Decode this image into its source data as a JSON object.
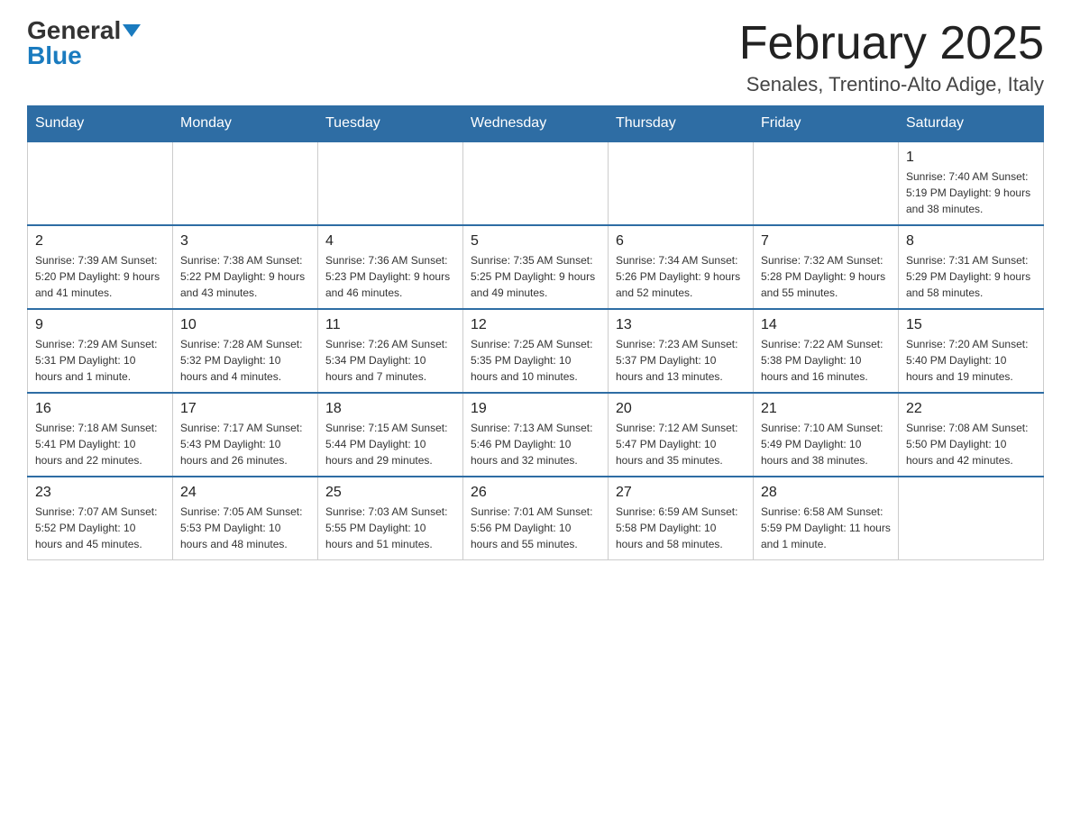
{
  "logo": {
    "general": "General",
    "blue": "Blue"
  },
  "title": "February 2025",
  "location": "Senales, Trentino-Alto Adige, Italy",
  "days_of_week": [
    "Sunday",
    "Monday",
    "Tuesday",
    "Wednesday",
    "Thursday",
    "Friday",
    "Saturday"
  ],
  "weeks": [
    [
      {
        "day": "",
        "info": ""
      },
      {
        "day": "",
        "info": ""
      },
      {
        "day": "",
        "info": ""
      },
      {
        "day": "",
        "info": ""
      },
      {
        "day": "",
        "info": ""
      },
      {
        "day": "",
        "info": ""
      },
      {
        "day": "1",
        "info": "Sunrise: 7:40 AM\nSunset: 5:19 PM\nDaylight: 9 hours and 38 minutes."
      }
    ],
    [
      {
        "day": "2",
        "info": "Sunrise: 7:39 AM\nSunset: 5:20 PM\nDaylight: 9 hours and 41 minutes."
      },
      {
        "day": "3",
        "info": "Sunrise: 7:38 AM\nSunset: 5:22 PM\nDaylight: 9 hours and 43 minutes."
      },
      {
        "day": "4",
        "info": "Sunrise: 7:36 AM\nSunset: 5:23 PM\nDaylight: 9 hours and 46 minutes."
      },
      {
        "day": "5",
        "info": "Sunrise: 7:35 AM\nSunset: 5:25 PM\nDaylight: 9 hours and 49 minutes."
      },
      {
        "day": "6",
        "info": "Sunrise: 7:34 AM\nSunset: 5:26 PM\nDaylight: 9 hours and 52 minutes."
      },
      {
        "day": "7",
        "info": "Sunrise: 7:32 AM\nSunset: 5:28 PM\nDaylight: 9 hours and 55 minutes."
      },
      {
        "day": "8",
        "info": "Sunrise: 7:31 AM\nSunset: 5:29 PM\nDaylight: 9 hours and 58 minutes."
      }
    ],
    [
      {
        "day": "9",
        "info": "Sunrise: 7:29 AM\nSunset: 5:31 PM\nDaylight: 10 hours and 1 minute."
      },
      {
        "day": "10",
        "info": "Sunrise: 7:28 AM\nSunset: 5:32 PM\nDaylight: 10 hours and 4 minutes."
      },
      {
        "day": "11",
        "info": "Sunrise: 7:26 AM\nSunset: 5:34 PM\nDaylight: 10 hours and 7 minutes."
      },
      {
        "day": "12",
        "info": "Sunrise: 7:25 AM\nSunset: 5:35 PM\nDaylight: 10 hours and 10 minutes."
      },
      {
        "day": "13",
        "info": "Sunrise: 7:23 AM\nSunset: 5:37 PM\nDaylight: 10 hours and 13 minutes."
      },
      {
        "day": "14",
        "info": "Sunrise: 7:22 AM\nSunset: 5:38 PM\nDaylight: 10 hours and 16 minutes."
      },
      {
        "day": "15",
        "info": "Sunrise: 7:20 AM\nSunset: 5:40 PM\nDaylight: 10 hours and 19 minutes."
      }
    ],
    [
      {
        "day": "16",
        "info": "Sunrise: 7:18 AM\nSunset: 5:41 PM\nDaylight: 10 hours and 22 minutes."
      },
      {
        "day": "17",
        "info": "Sunrise: 7:17 AM\nSunset: 5:43 PM\nDaylight: 10 hours and 26 minutes."
      },
      {
        "day": "18",
        "info": "Sunrise: 7:15 AM\nSunset: 5:44 PM\nDaylight: 10 hours and 29 minutes."
      },
      {
        "day": "19",
        "info": "Sunrise: 7:13 AM\nSunset: 5:46 PM\nDaylight: 10 hours and 32 minutes."
      },
      {
        "day": "20",
        "info": "Sunrise: 7:12 AM\nSunset: 5:47 PM\nDaylight: 10 hours and 35 minutes."
      },
      {
        "day": "21",
        "info": "Sunrise: 7:10 AM\nSunset: 5:49 PM\nDaylight: 10 hours and 38 minutes."
      },
      {
        "day": "22",
        "info": "Sunrise: 7:08 AM\nSunset: 5:50 PM\nDaylight: 10 hours and 42 minutes."
      }
    ],
    [
      {
        "day": "23",
        "info": "Sunrise: 7:07 AM\nSunset: 5:52 PM\nDaylight: 10 hours and 45 minutes."
      },
      {
        "day": "24",
        "info": "Sunrise: 7:05 AM\nSunset: 5:53 PM\nDaylight: 10 hours and 48 minutes."
      },
      {
        "day": "25",
        "info": "Sunrise: 7:03 AM\nSunset: 5:55 PM\nDaylight: 10 hours and 51 minutes."
      },
      {
        "day": "26",
        "info": "Sunrise: 7:01 AM\nSunset: 5:56 PM\nDaylight: 10 hours and 55 minutes."
      },
      {
        "day": "27",
        "info": "Sunrise: 6:59 AM\nSunset: 5:58 PM\nDaylight: 10 hours and 58 minutes."
      },
      {
        "day": "28",
        "info": "Sunrise: 6:58 AM\nSunset: 5:59 PM\nDaylight: 11 hours and 1 minute."
      },
      {
        "day": "",
        "info": ""
      }
    ]
  ]
}
